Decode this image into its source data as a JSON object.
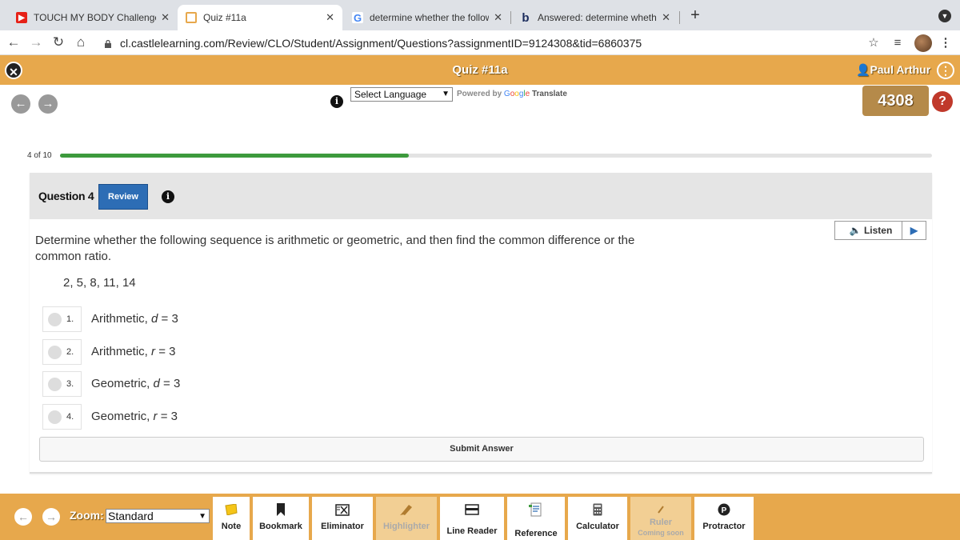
{
  "browser": {
    "tabs": [
      {
        "title": "TOUCH MY BODY Challenge w",
        "favicon": "youtube-icon"
      },
      {
        "title": "Quiz #11a",
        "favicon": "castle-learning-icon"
      },
      {
        "title": "determine whether the followin",
        "favicon": "google-icon"
      },
      {
        "title": "Answered: determine whether",
        "favicon": "bartleby-icon"
      }
    ],
    "url": "cl.castlelearning.com/Review/CLO/Student/Assignment/Questions?assignmentID=9124308&tid=6860375"
  },
  "app": {
    "title": "Quiz #11a",
    "user": "Paul Arthur",
    "language_select": "Select Language",
    "powered_by": "Powered by",
    "google": "Google",
    "translate": "Translate",
    "score": "4308",
    "help": "?"
  },
  "progress": {
    "label": "4 of 10",
    "fraction": 0.4
  },
  "question": {
    "number": "Question 4",
    "review_label": "Review",
    "listen_label": "Listen",
    "prompt": "Determine whether the following sequence is arithmetic or geometric, and then find the common difference or the common ratio.",
    "sequence": "2, 5, 8, 11, 14",
    "choices": [
      {
        "num": "1.",
        "type": "Arithmetic,",
        "var": "d",
        "rest": " = 3"
      },
      {
        "num": "2.",
        "type": "Arithmetic,",
        "var": "r",
        "rest": " = 3"
      },
      {
        "num": "3.",
        "type": "Geometric,",
        "var": "d",
        "rest": " = 3"
      },
      {
        "num": "4.",
        "type": "Geometric,",
        "var": "r",
        "rest": " = 3"
      }
    ],
    "submit_label": "Submit Answer"
  },
  "toolbar": {
    "zoom_label": "Zoom:",
    "zoom_value": "Standard",
    "tools": [
      {
        "label": "Note",
        "icon": "note-icon"
      },
      {
        "label": "Bookmark",
        "icon": "bookmark-icon"
      },
      {
        "label": "Eliminator",
        "icon": "eliminator-icon"
      },
      {
        "label": "Highlighter",
        "icon": "highlighter-icon"
      },
      {
        "label": "Line Reader",
        "icon": "line-reader-icon"
      },
      {
        "label": "Reference",
        "icon": "reference-icon"
      },
      {
        "label": "Calculator",
        "icon": "calculator-icon"
      },
      {
        "label": "Ruler",
        "icon": "ruler-icon",
        "sub": "Coming soon"
      },
      {
        "label": "Protractor",
        "icon": "protractor-icon"
      }
    ]
  },
  "colors": {
    "accent": "#e7a84c",
    "review_button": "#2d6db5",
    "progress": "#3d9a3d",
    "help": "#c0392b",
    "score_bg": "#b58a4a"
  }
}
